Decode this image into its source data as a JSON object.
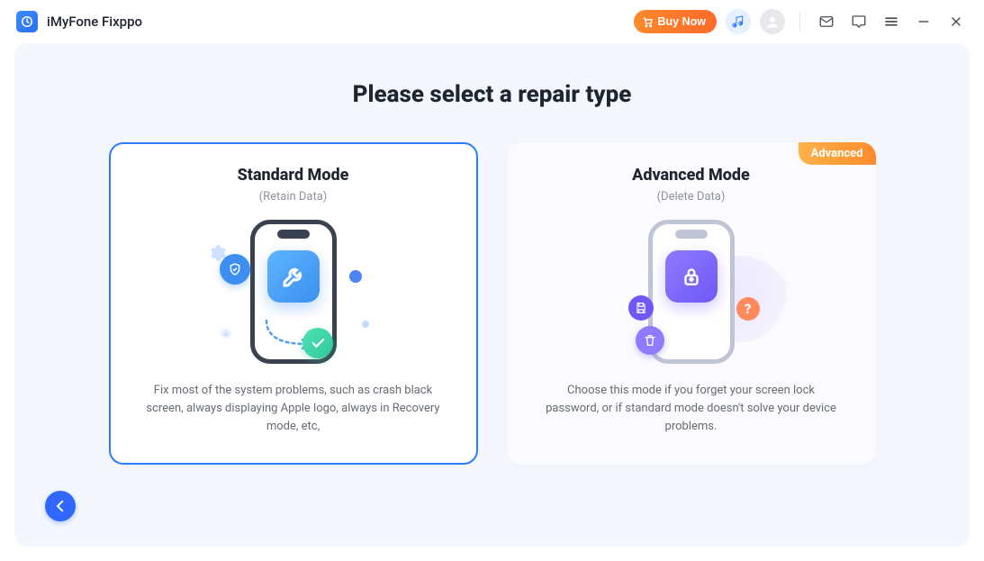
{
  "header": {
    "app_title": "iMyFone Fixppo",
    "buy_now_label": "Buy Now"
  },
  "main": {
    "page_title": "Please select a repair type",
    "cards": {
      "standard": {
        "title": "Standard Mode",
        "subtitle": "(Retain Data)",
        "description": "Fix most of the system problems, such as crash black screen, always displaying Apple logo, always in Recovery mode, etc,"
      },
      "advanced": {
        "badge": "Advanced",
        "title": "Advanced Mode",
        "subtitle": "(Delete Data)",
        "description": "Choose this mode if you forget your screen lock password, or if standard mode doesn't solve your device problems.",
        "question_mark": "?"
      }
    }
  },
  "icons": {
    "app_logo": "fixppo-logo",
    "cart": "cart-icon",
    "music": "music-note-icon",
    "avatar": "avatar-icon",
    "mail": "mail-icon",
    "feedback": "comment-icon",
    "menu": "menu-icon",
    "minimize": "minimize-icon",
    "close": "close-icon",
    "back": "arrow-left-icon"
  },
  "colors": {
    "accent_blue": "#2f7bff",
    "accent_orange": "#ff7a2b",
    "accent_purple": "#6f58f6",
    "bg_panel": "#f4f8fe"
  }
}
